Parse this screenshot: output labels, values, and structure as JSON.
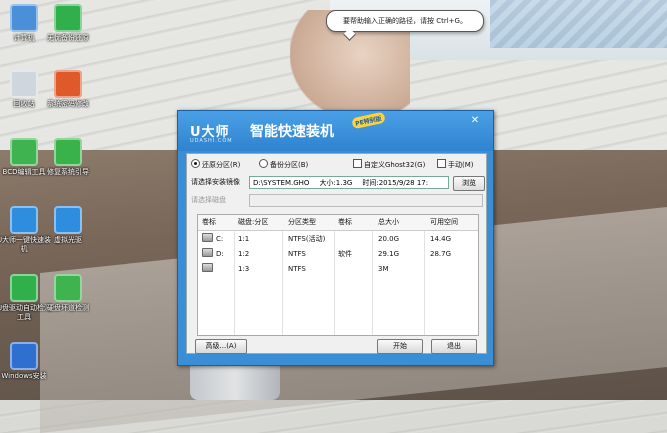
{
  "desktop": {
    "icons": [
      {
        "label": "计算机",
        "color": "#4a90d9",
        "kind": "computer-icon"
      },
      {
        "label": "无忧备份还原",
        "color": "#2fb04a",
        "kind": "backup-icon"
      },
      {
        "label": "回收站",
        "color": "#cfd6dd",
        "kind": "recycle-bin-icon"
      },
      {
        "label": "系统密码修改",
        "color": "#e0592a",
        "kind": "password-icon"
      },
      {
        "label": "BCD编辑工具",
        "color": "#3fb34f",
        "kind": "gear-icon"
      },
      {
        "label": "修复系统引导",
        "color": "#39b24a",
        "kind": "repair-icon"
      },
      {
        "label": "U大师一键快速装机",
        "color": "#2f8ddf",
        "kind": "ghost-icon"
      },
      {
        "label": "虚拟光驱",
        "color": "#2f8ddf",
        "kind": "virtual-drive-icon"
      },
      {
        "label": "U盘驱动自动检测工具",
        "color": "#2fb04a",
        "kind": "usb-icon"
      },
      {
        "label": "硬盘坏道检测",
        "color": "#3fb34f",
        "kind": "disk-check-icon"
      },
      {
        "label": "Windows安装",
        "color": "#2f6fd0",
        "kind": "windows-icon"
      }
    ]
  },
  "tooltip": "要帮助输入正确的路径，请按 Ctrl+G。",
  "dialog": {
    "logo": "U大师",
    "logo_sub": "UDASHI.COM",
    "title": "智能快速装机",
    "badge": "PE特别版",
    "close": "✕",
    "restore_label": "还原分区(R)",
    "backup_label": "备份分区(B)",
    "custom_ghost_label": "自定义Ghost32(G)",
    "manual_label": "手动(M)",
    "image_file_label": "请选择安装镜像",
    "image_path": "D:\\SYSTEM.GHO",
    "image_size": "大小:1.3G",
    "image_time": "时间:2015/9/28 17:",
    "browse_label": "浏览",
    "disk_label": "请选择磁盘",
    "columns": [
      "卷标",
      "磁盘:分区",
      "分区类型",
      "卷标",
      "总大小",
      "可用空间"
    ],
    "rows": [
      {
        "drive": "C:",
        "disk": "1:1",
        "type": "NTFS(活动)",
        "label": "",
        "total": "20.0G",
        "free": "14.4G"
      },
      {
        "drive": "D:",
        "disk": "1:2",
        "type": "NTFS",
        "label": "软件",
        "total": "29.1G",
        "free": "28.7G"
      },
      {
        "drive": "",
        "disk": "1:3",
        "type": "NTFS",
        "label": "",
        "total": "3M",
        "free": ""
      }
    ],
    "advanced_label": "高级...(A)",
    "start_label": "开始",
    "exit_label": "退出"
  }
}
